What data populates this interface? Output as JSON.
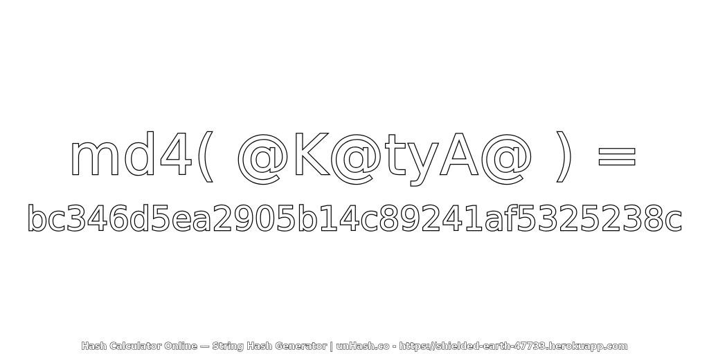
{
  "expression": "md4( @K@tyA@ ) =",
  "hash": "bc346d5ea2905b14c89241af5325238c",
  "footer": "Hash Calculator Online — String Hash Generator | unHash.co - https://shielded-earth-47733.herokuapp.com"
}
